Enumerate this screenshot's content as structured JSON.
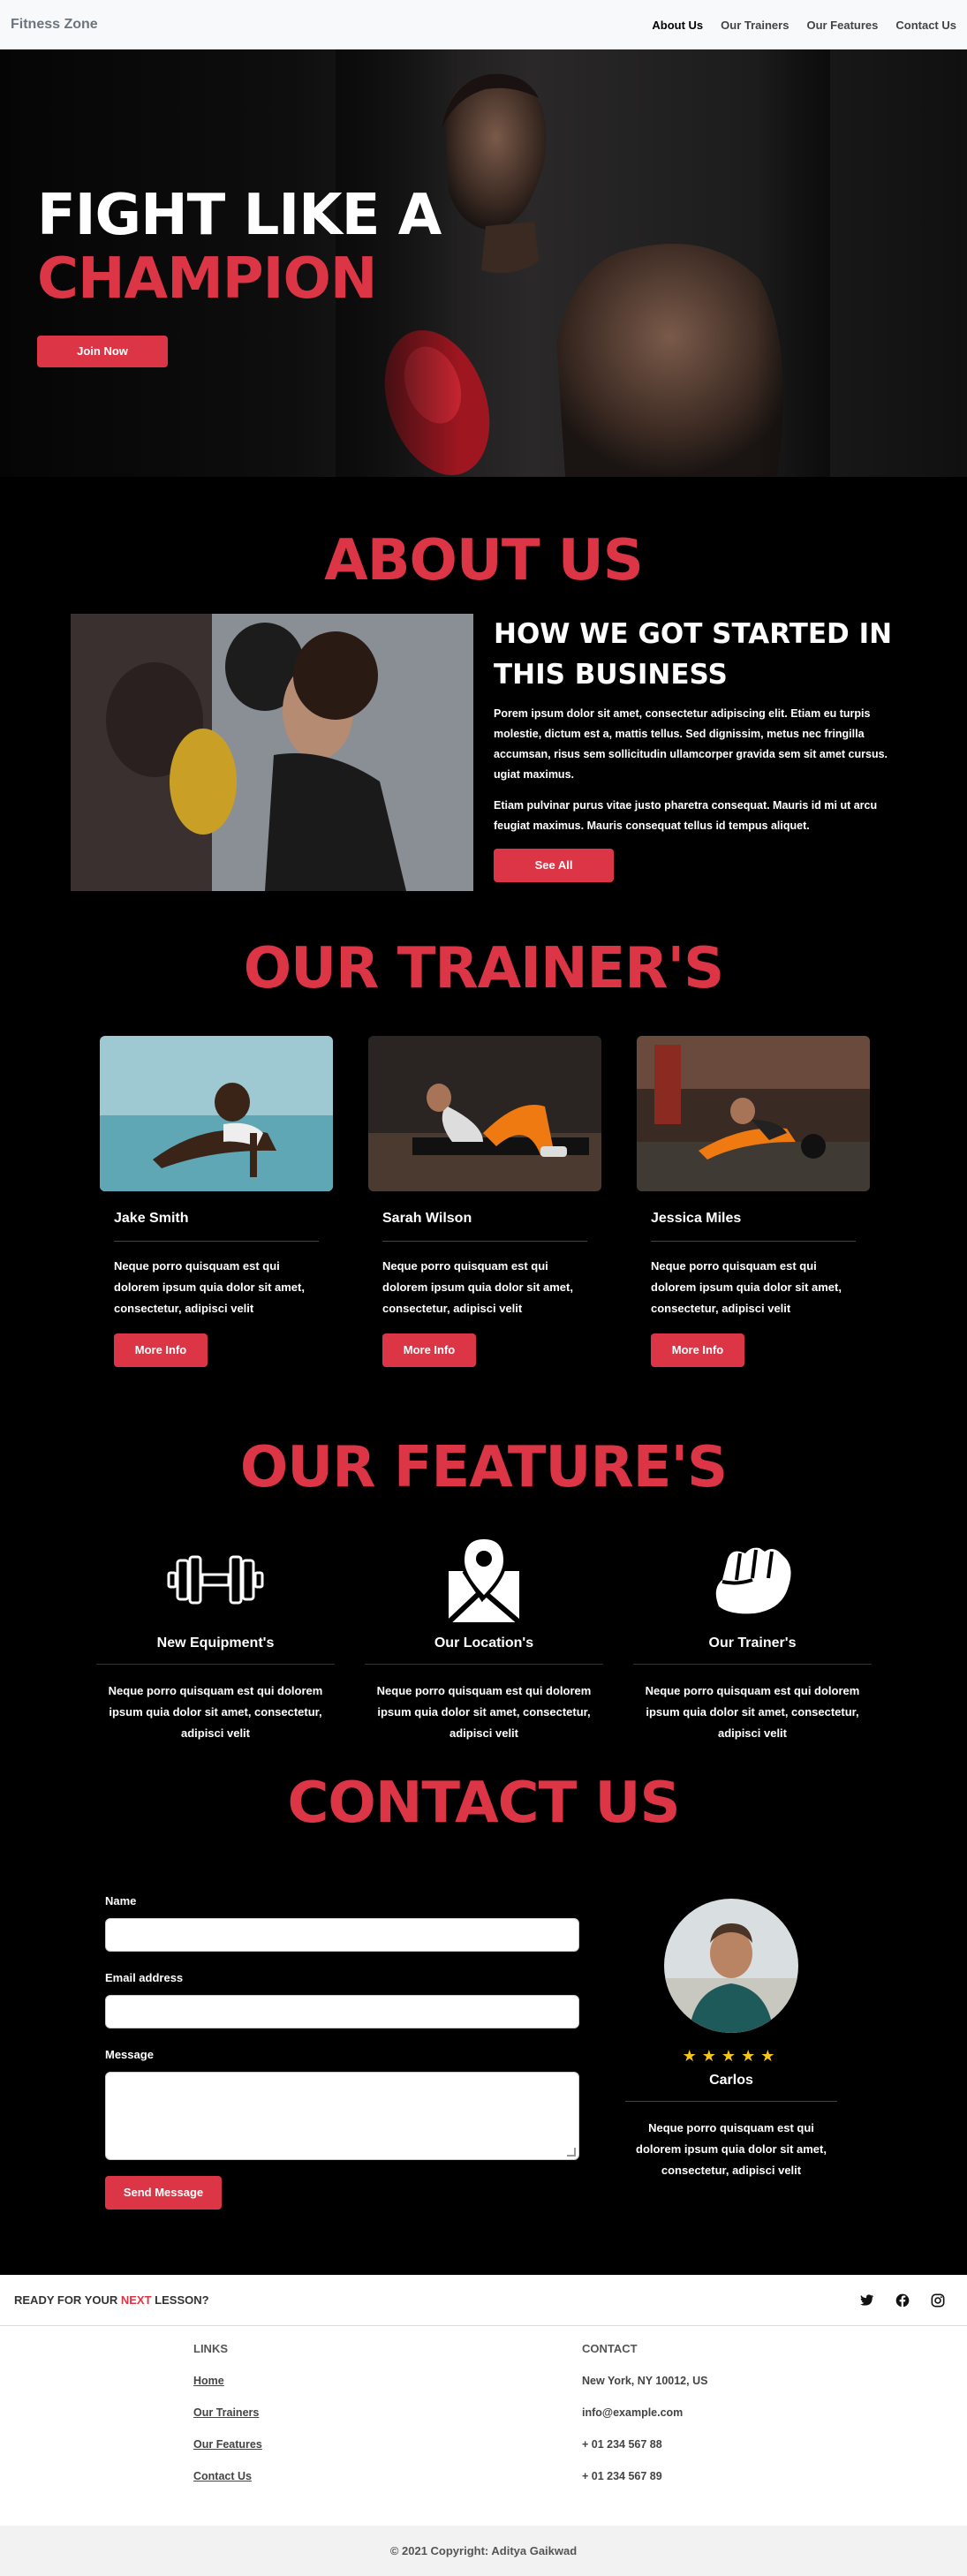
{
  "nav": {
    "brand": "Fitness Zone",
    "links": [
      "About Us",
      "Our Trainers",
      "Our Features",
      "Contact Us"
    ]
  },
  "hero": {
    "line1": "FIGHT LIKE A",
    "line2": "CHAMPION",
    "button": "Join Now"
  },
  "about": {
    "title": "ABOUT US",
    "heading": "HOW WE GOT STARTED IN THIS BUSINESS",
    "para1": "Porem ipsum dolor sit amet, consectetur adipiscing elit. Etiam eu turpis molestie, dictum est a, mattis tellus. Sed dignissim, metus nec fringilla accumsan, risus sem sollicitudin ullamcorper gravida sem sit amet cursus. ugiat maximus.",
    "para2": "Etiam pulvinar purus vitae justo pharetra consequat. Mauris id mi ut arcu feugiat maximus. Mauris consequat tellus id tempus aliquet.",
    "button": "See All"
  },
  "trainers": {
    "title": "OUR TRAINER'S",
    "items": [
      {
        "name": "Jake Smith",
        "desc": "Neque porro quisquam est qui dolorem ipsum quia dolor sit amet, consectetur, adipisci velit",
        "button": "More Info"
      },
      {
        "name": "Sarah Wilson",
        "desc": "Neque porro quisquam est qui dolorem ipsum quia dolor sit amet, consectetur, adipisci velit",
        "button": "More Info"
      },
      {
        "name": "Jessica Miles",
        "desc": "Neque porro quisquam est qui dolorem ipsum quia dolor sit amet, consectetur, adipisci velit",
        "button": "More Info"
      }
    ]
  },
  "features": {
    "title": "OUR FEATURE'S",
    "items": [
      {
        "icon": "dumbbell-icon",
        "title": "New Equipment's",
        "desc": "Neque porro quisquam est qui dolorem ipsum quia dolor sit amet, consectetur, adipisci velit"
      },
      {
        "icon": "map-pin-icon",
        "title": "Our Location's",
        "desc": "Neque porro quisquam est qui dolorem ipsum quia dolor sit amet, consectetur, adipisci velit"
      },
      {
        "icon": "fist-icon",
        "title": "Our Trainer's",
        "desc": "Neque porro quisquam est qui dolorem ipsum quia dolor sit amet, consectetur, adipisci velit"
      }
    ]
  },
  "contact": {
    "title": "CONTACT US",
    "name_label": "Name",
    "email_label": "Email address",
    "message_label": "Message",
    "button": "Send Message",
    "profile": {
      "stars": "★★★★★",
      "name": "Carlos",
      "desc": "Neque porro quisquam est qui dolorem ipsum quia dolor sit amet, consectetur, adipisci velit"
    }
  },
  "footer": {
    "ready_prefix": "READY FOR YOUR ",
    "ready_highlight": "NEXT",
    "ready_suffix": " LESSON?",
    "links_title": "LINKS",
    "links": [
      "Home",
      "Our Trainers",
      "Our Features",
      "Contact Us"
    ],
    "contact_title": "CONTACT",
    "contact_items": [
      "New York, NY 10012, US",
      "info@example.com",
      "+ 01 234 567 88",
      "+ 01 234 567 89"
    ],
    "copyright": "© 2021 Copyright: Aditya Gaikwad"
  },
  "colors": {
    "accent": "#dc3545",
    "star": "#f5c518"
  }
}
